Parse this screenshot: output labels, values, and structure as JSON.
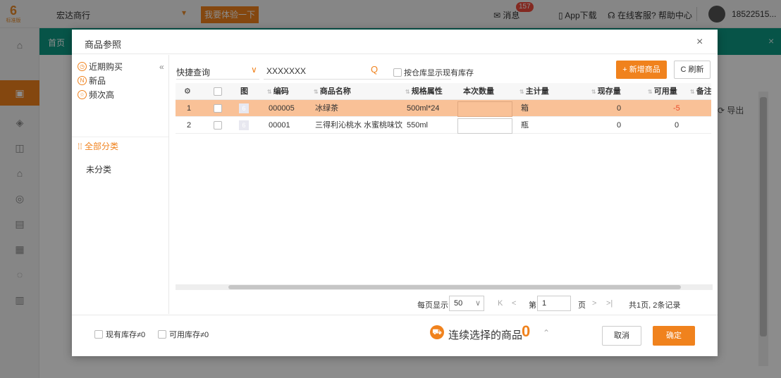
{
  "app": {
    "logo_text": "6",
    "logo_sub": "标准版",
    "store_name": "宏达商行",
    "try_button": "我要体验一下",
    "msg_label": "消息",
    "msg_count": "157",
    "app_download": "App下载",
    "online_service": "在线客服",
    "help_center": "帮助中心",
    "user": "18522515...",
    "home_tab": "首页",
    "export": "导出"
  },
  "modal": {
    "title": "商品参照",
    "close": "×",
    "left": {
      "recent": "近期购买",
      "new": "新品",
      "frequent": "频次高",
      "collapse": "«",
      "all_category": "全部分类",
      "uncategorized": "未分类"
    },
    "toolbar": {
      "quick_query": "快捷查询",
      "search_value": "XXXXXXX",
      "show_stock": "按仓库显示现有库存",
      "add_button": "+ 新增商品",
      "refresh_button": "C 刷新"
    },
    "table": {
      "headers": [
        "",
        "",
        "图",
        "编码",
        "商品名称",
        "规格属性",
        "本次数量",
        "主计量",
        "现存量",
        "可用量",
        "备注"
      ],
      "rows": [
        {
          "idx": "1",
          "code": "000005",
          "name": "冰绿茶",
          "spec": "500ml*24",
          "qty": "",
          "unit": "箱",
          "stock": "0",
          "available": "-5"
        },
        {
          "idx": "2",
          "code": "00001",
          "name": "三得利沁桃水 水蜜桃味饮料",
          "spec": "550ml",
          "qty": "",
          "unit": "瓶",
          "stock": "0",
          "available": "0"
        }
      ]
    },
    "pagination": {
      "per_page_label": "每页显示",
      "per_page": "50",
      "page_prefix": "第",
      "page": "1",
      "page_suffix": "页",
      "total": "共1页, 2条记录"
    },
    "footer": {
      "stock_nonzero": "现有库存≠0",
      "available_nonzero": "可用库存≠0",
      "continuous_select": "连续选择的商品",
      "selected_count": "0",
      "cancel": "取消",
      "confirm": "确定"
    }
  },
  "colors": {
    "accent": "#f0821d",
    "green": "#0e9a84",
    "selected_row": "#f9c197",
    "negative": "#e94b2b"
  }
}
